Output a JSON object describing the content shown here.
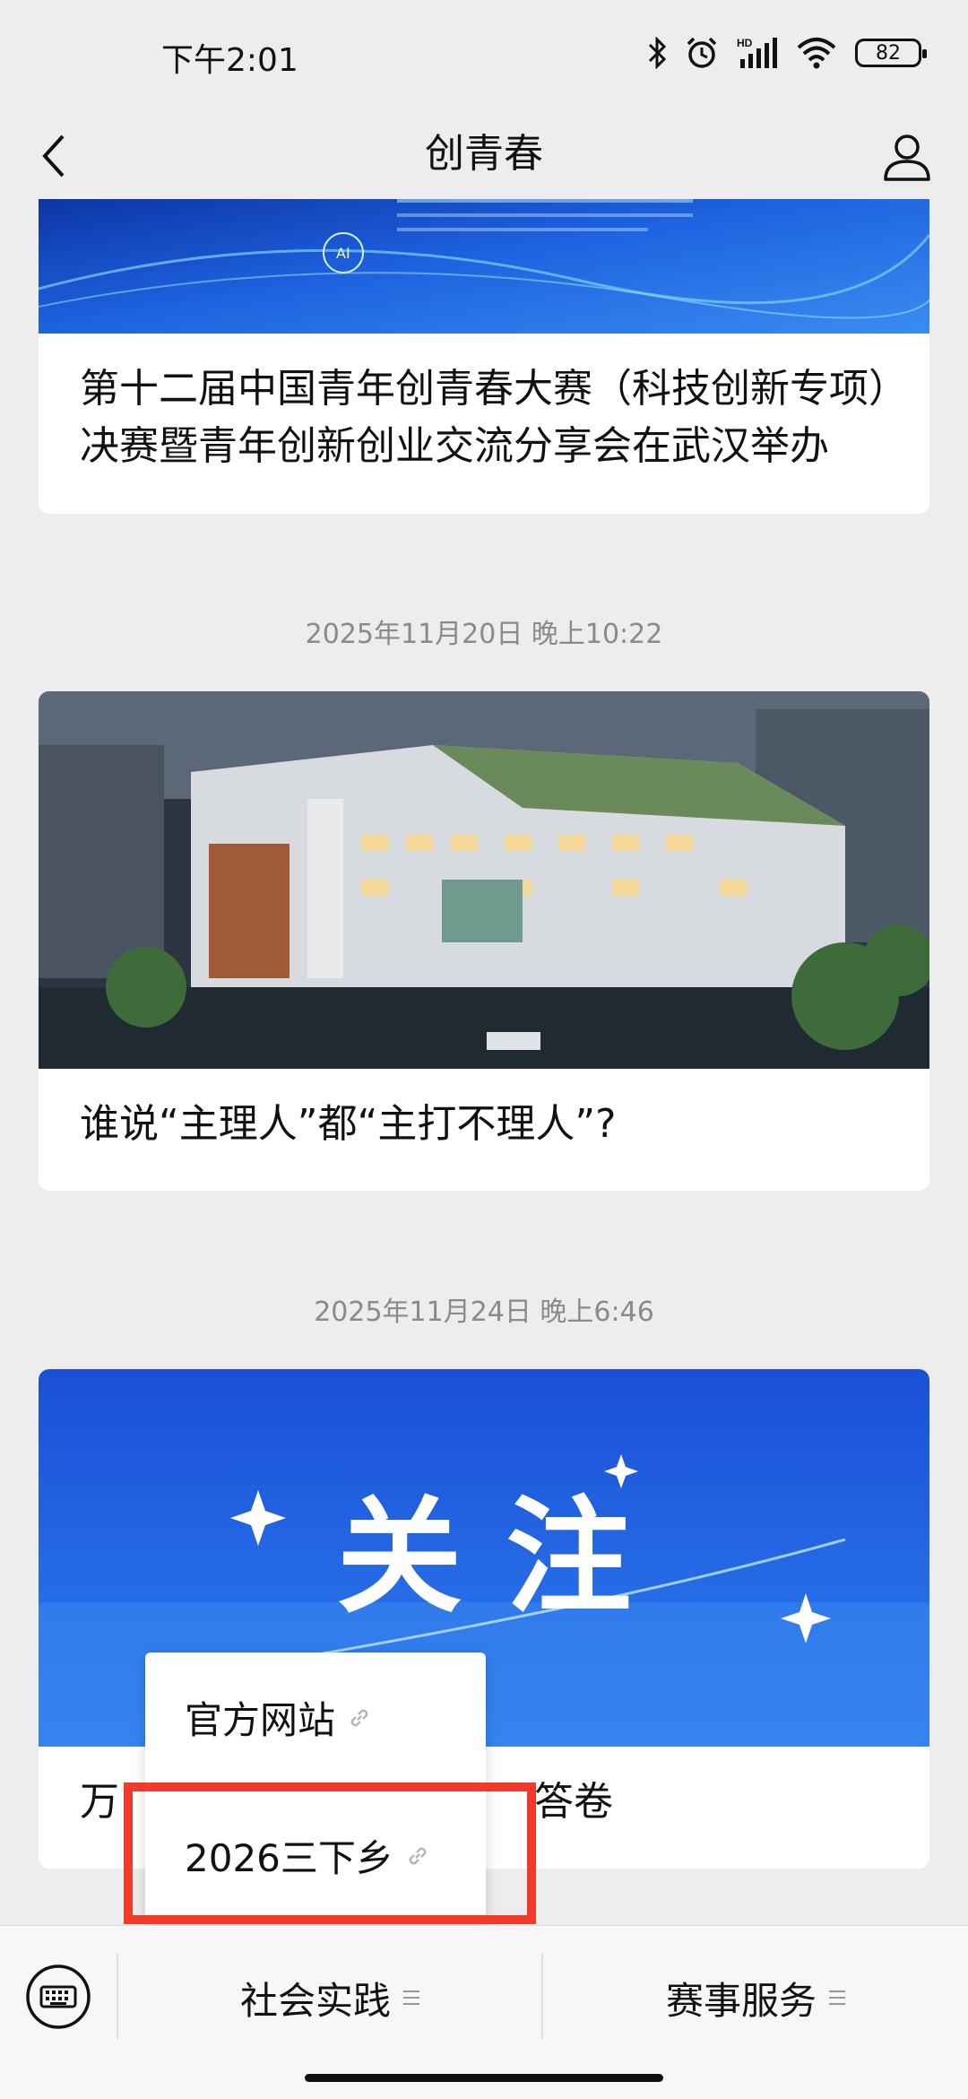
{
  "status_bar": {
    "time": "下午2:01",
    "battery": "82",
    "network_badge": "HD",
    "icons": [
      "bluetooth-icon",
      "alarm-icon",
      "signal-icon",
      "wifi-icon",
      "battery-icon"
    ]
  },
  "nav": {
    "title": "创青春",
    "back_icon": "chevron-left-icon",
    "profile_icon": "person-icon"
  },
  "feed": {
    "articles": [
      {
        "title_line1": "第十二届中国青年创青春大赛（科技创新专项）",
        "title_line2": "决赛暨青年创新创业交流分享会在武汉举办",
        "banner_text": "AI"
      },
      {
        "timestamp": "2025年11月20日 晚上10:22",
        "title": "谁说“主理人”都“主打不理人”?"
      },
      {
        "timestamp": "2025年11月24日 晚上6:46",
        "banner_text": "关 注",
        "title_visible_start": "万",
        "title_visible_end": "答卷"
      }
    ]
  },
  "popup_menu": {
    "items": [
      {
        "label": "官方网站",
        "icon": "link-icon"
      },
      {
        "label": "2026三下乡",
        "icon": "link-icon"
      }
    ]
  },
  "bottom_menu": {
    "keyboard_icon": "keyboard-icon",
    "items": [
      {
        "label": "社会实践",
        "icon": "menu-lines-icon"
      },
      {
        "label": "赛事服务",
        "icon": "menu-lines-icon"
      }
    ]
  },
  "colors": {
    "background": "#ededed",
    "highlight": "#f23a2a",
    "banner_blue": "#1e63e0"
  }
}
